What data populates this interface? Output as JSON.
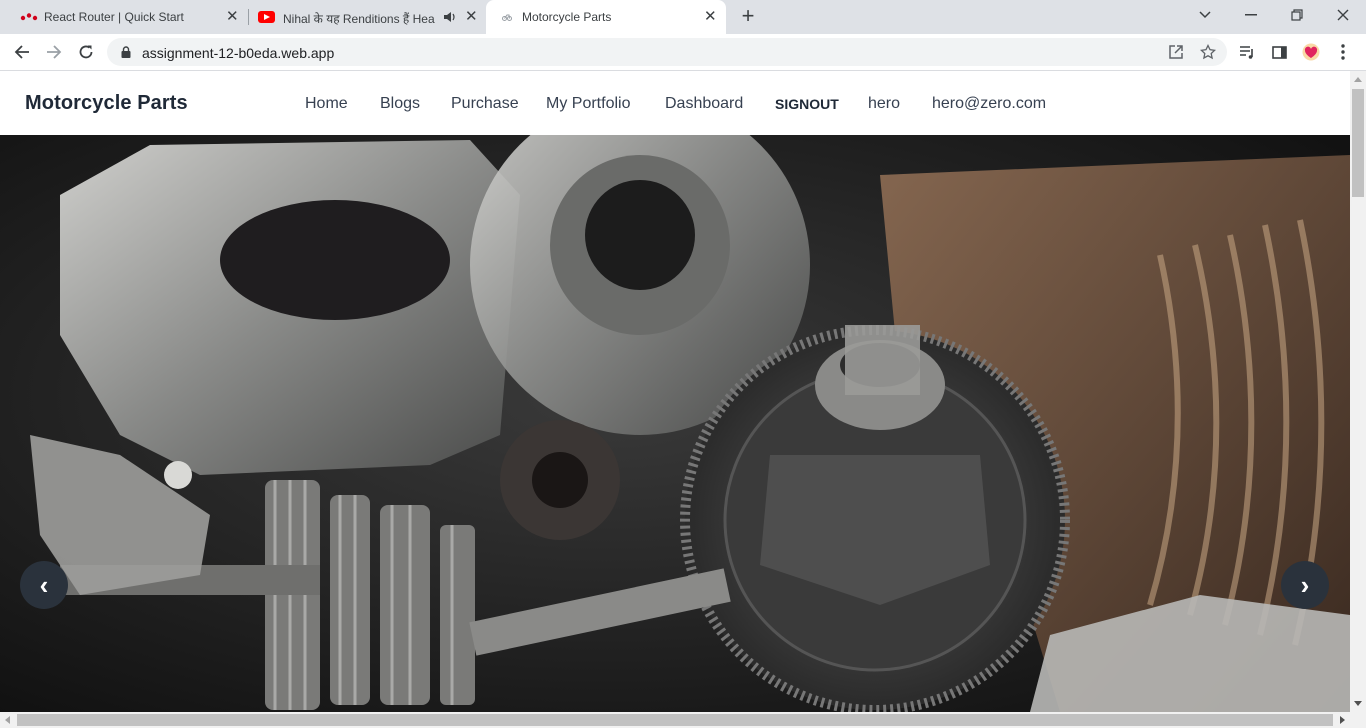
{
  "browser": {
    "tabs": [
      {
        "title": "React Router | Quick Start",
        "favicon": "react-router-icon",
        "active": false
      },
      {
        "title": "Nihal के यह Renditions हैं Hea",
        "favicon": "youtube-icon",
        "audio": true,
        "active": false
      },
      {
        "title": "Motorcycle Parts",
        "favicon": "site-icon",
        "active": true
      }
    ],
    "url": "assignment-12-b0eda.web.app"
  },
  "site": {
    "brand": "Motorcycle Parts",
    "nav": [
      "Home",
      "Blogs",
      "Purchase",
      "My Portfolio",
      "Dashboard",
      "SIGNOUT",
      "hero",
      "hero@zero.com"
    ]
  },
  "hero": {
    "image_subject": "disassembled motorcycle engine parts and gears",
    "prev_icon": "‹",
    "next_icon": "›"
  },
  "colors": {
    "tab_strip": "#dee1e6",
    "carousel_button": "#2a323c",
    "brand_text": "#1f2937"
  }
}
